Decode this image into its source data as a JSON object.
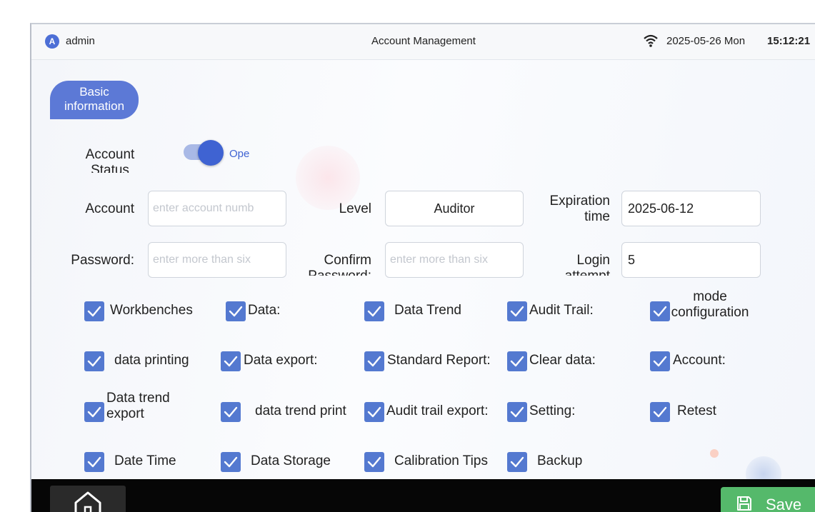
{
  "status_bar": {
    "avatar_letter": "A",
    "user": "admin",
    "title": "Account Management",
    "date": "2025-05-26 Mon",
    "time": "15:12:21"
  },
  "tab": {
    "label": "Basic information"
  },
  "account_status": {
    "label": "Account Status",
    "toggle_text": "Ope"
  },
  "fields": {
    "account_label": "Account",
    "account_placeholder": "enter account numb",
    "level_label": "Level",
    "level_value": "Auditor",
    "expiration_label": "Expiration time",
    "expiration_value": "2025-06-12",
    "password_label": "Password:",
    "password_placeholder": "enter more than six",
    "confirm_label": "Confirm Password:",
    "confirm_placeholder": "enter more than six",
    "login_label": "Login attempt",
    "login_value": "5"
  },
  "permissions": [
    {
      "label": "Workbenches",
      "checked": true
    },
    {
      "label": "Data:",
      "checked": true
    },
    {
      "label": "Data Trend",
      "checked": true
    },
    {
      "label": "Audit Trail:",
      "checked": true
    },
    {
      "label": "mode configuration",
      "checked": true
    },
    {
      "label": "data printing",
      "checked": true
    },
    {
      "label": "Data export:",
      "checked": true
    },
    {
      "label": "Standard Report:",
      "checked": true
    },
    {
      "label": "Clear data:",
      "checked": true
    },
    {
      "label": "Account:",
      "checked": true
    },
    {
      "label": "Data trend export",
      "checked": true
    },
    {
      "label": "data trend print",
      "checked": true
    },
    {
      "label": "Audit trail export:",
      "checked": true
    },
    {
      "label": "Setting:",
      "checked": true
    },
    {
      "label": "Retest",
      "checked": true
    },
    {
      "label": "Date Time",
      "checked": true
    },
    {
      "label": "Data Storage",
      "checked": true
    },
    {
      "label": "Calibration Tips",
      "checked": true
    },
    {
      "label": "Backup",
      "checked": true
    }
  ],
  "bottom_bar": {
    "save_label": "Save"
  },
  "colors": {
    "accent": "#5479d0",
    "save": "#55b96b",
    "toggle_knob": "#3f63d2"
  }
}
